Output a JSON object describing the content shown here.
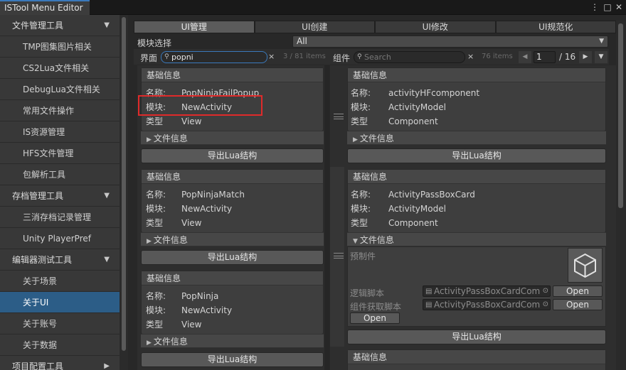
{
  "window": {
    "title": "ISTool Menu Editor",
    "controls": [
      "⋮",
      "□",
      "✕"
    ]
  },
  "sidebar": {
    "items": [
      {
        "label": "文件管理工具",
        "type": "cat",
        "arrow": "▼"
      },
      {
        "label": "TMP图集图片相关",
        "type": "sub"
      },
      {
        "label": "CS2Lua文件相关",
        "type": "sub"
      },
      {
        "label": "DebugLua文件相关",
        "type": "sub"
      },
      {
        "label": "常用文件操作",
        "type": "sub"
      },
      {
        "label": "IS资源管理",
        "type": "sub"
      },
      {
        "label": "HFS文件管理",
        "type": "sub"
      },
      {
        "label": "包解析工具",
        "type": "sub"
      },
      {
        "label": "存档管理工具",
        "type": "cat",
        "arrow": "▼"
      },
      {
        "label": "三消存档记录管理",
        "type": "sub"
      },
      {
        "label": "Unity PlayerPref",
        "type": "sub"
      },
      {
        "label": "编辑器测试工具",
        "type": "cat",
        "arrow": "▼"
      },
      {
        "label": "关于场景",
        "type": "sub"
      },
      {
        "label": "关于UI",
        "type": "sub",
        "selected": true
      },
      {
        "label": "关于账号",
        "type": "sub"
      },
      {
        "label": "关于数据",
        "type": "sub"
      },
      {
        "label": "项目配置工具",
        "type": "cat",
        "arrow": "▶"
      }
    ]
  },
  "tabs": [
    {
      "label": "UI管理",
      "active": true
    },
    {
      "label": "UI创建"
    },
    {
      "label": "UI修改"
    },
    {
      "label": "UI规范化"
    }
  ],
  "module_select": {
    "label": "模块选择",
    "value": "All",
    "arrow": "▼"
  },
  "left_header": {
    "label": "界面",
    "search_value": "popni",
    "clear": "×",
    "count": "3 / 81 items"
  },
  "right_header": {
    "label": "组件",
    "search_placeholder": "Search",
    "clear": "×",
    "count": "76 items",
    "prev": "◀",
    "page": "1",
    "total": "/ 16",
    "next": "▶",
    "menu": "▼"
  },
  "labels": {
    "basic_info": "基础信息",
    "name": "名称:",
    "module": "模块:",
    "type": "类型",
    "file_info": "文件信息",
    "export": "导出Lua结构",
    "prefab": "预制件",
    "logic_script": "逻辑脚本",
    "component_script": "组件获取脚本",
    "open": "Open",
    "fold_closed": "▶",
    "fold_open": "▼"
  },
  "ui_list": [
    {
      "name": "PopNinjaFailPopup",
      "module": "NewActivity",
      "type": "View"
    },
    {
      "name": "PopNinjaMatch",
      "module": "NewActivity",
      "type": "View"
    },
    {
      "name": "PopNinja",
      "module": "NewActivity",
      "type": "View"
    }
  ],
  "component_list": [
    {
      "name": "activityHFcomponent",
      "module": "ActivityModel",
      "type": "Component"
    },
    {
      "name": "ActivityPassBoxCard",
      "module": "ActivityModel",
      "type": "Component",
      "files": {
        "logic_script": "ActivityPassBoxCardCom",
        "component_script": "ActivityPassBoxCardCom"
      }
    }
  ],
  "colors": {
    "accent_selected": "#2c5d87",
    "highlight_box": "#e02a2a"
  }
}
